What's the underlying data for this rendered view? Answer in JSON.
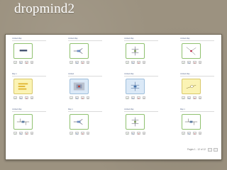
{
  "slide": {
    "title": "dropmind2"
  },
  "cards": [
    {
      "title": "Untitled Map",
      "thumb": "flat-bar"
    },
    {
      "title": "Untitled Map",
      "thumb": "tree"
    },
    {
      "title": "Untitled Map",
      "thumb": "branches"
    },
    {
      "title": "Untitled Map",
      "thumb": "radial"
    },
    {
      "title": "Map 1",
      "thumb": "yellow-bars"
    },
    {
      "title": "Untitled",
      "thumb": "hatched"
    },
    {
      "title": "Untitled Map",
      "thumb": "blue-tree"
    },
    {
      "title": "Untitled Map",
      "thumb": "yellow-node"
    },
    {
      "title": "Untitled Map",
      "thumb": "dual"
    },
    {
      "title": "Map 1",
      "thumb": "tree"
    },
    {
      "title": "Untitled Map",
      "thumb": "branches"
    },
    {
      "title": "Map 1",
      "thumb": "dual"
    }
  ],
  "card_actions": {
    "open": "✓",
    "edit": "✎",
    "delete": "✕",
    "more": "▾"
  },
  "pagination": {
    "label": "Pages 1 - 12 of 12"
  },
  "colors": {
    "background": "#9c9280",
    "thumb_border": "#8fc16f",
    "blue_thumb": "#dbe9f7",
    "yellow_thumb": "#fbf3b4"
  }
}
